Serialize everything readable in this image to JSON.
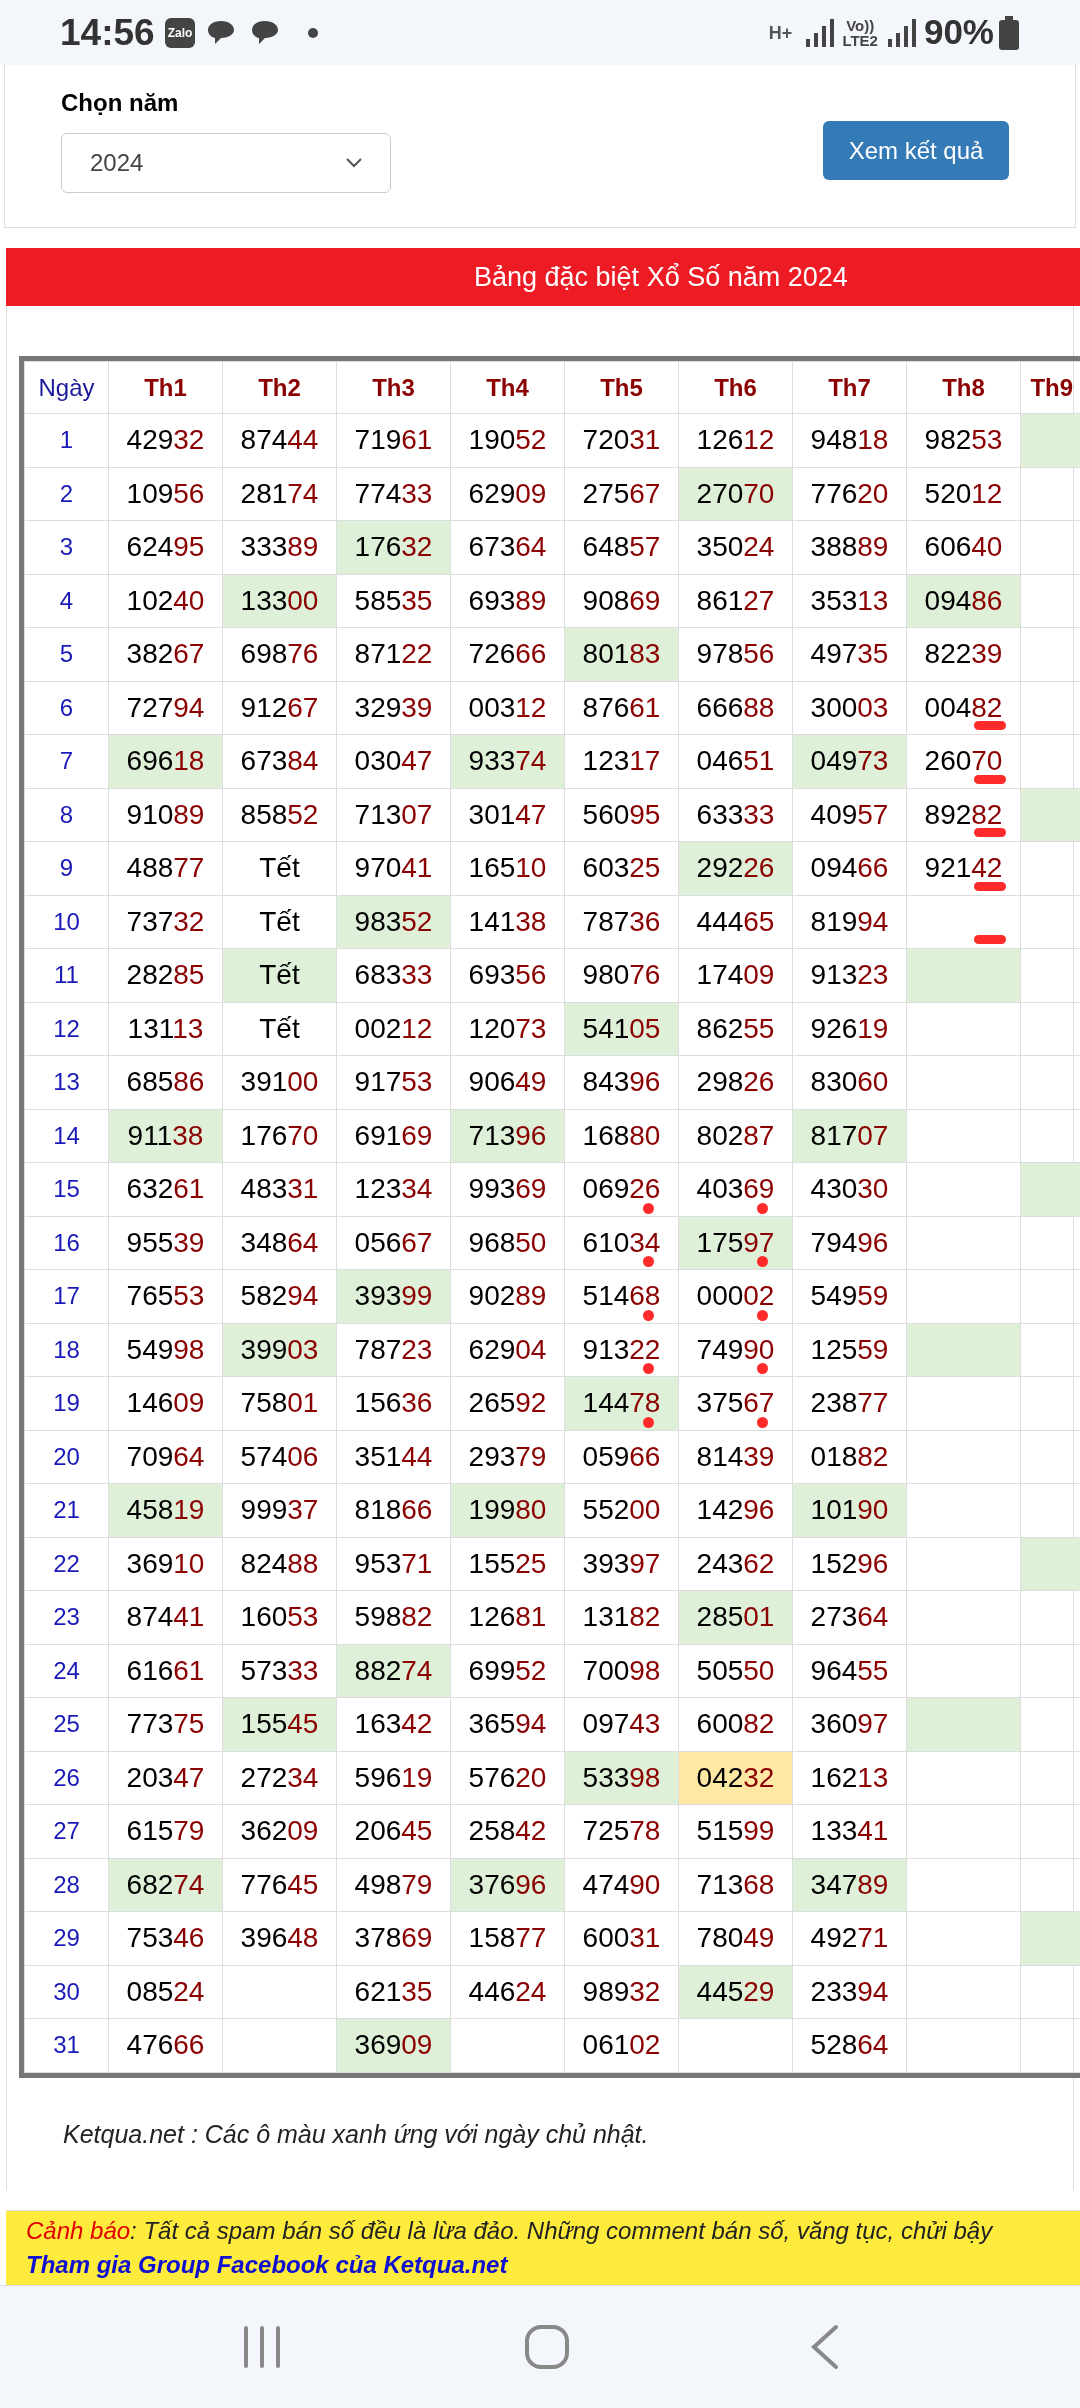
{
  "status_bar": {
    "time": "14:56",
    "app_badge": "Zalo",
    "network": "H+",
    "volte": "Vo))",
    "lte": "LTE2",
    "battery": "90%"
  },
  "year_form": {
    "label": "Chọn năm",
    "select_value": "2024",
    "button": "Xem kết quả"
  },
  "banner": {
    "title": "Bảng đặc biệt Xổ Số năm 2024"
  },
  "table": {
    "columns": [
      "Ngày",
      "Th1",
      "Th2",
      "Th3",
      "Th4",
      "Th5",
      "Th6",
      "Th7",
      "Th8",
      "Th9"
    ],
    "rows": [
      {
        "cells": [
          {
            "kind": "day",
            "value": "1"
          },
          {
            "kind": "number",
            "head": "429",
            "tail": "32"
          },
          {
            "kind": "number",
            "head": "874",
            "tail": "44"
          },
          {
            "kind": "number",
            "head": "719",
            "tail": "61"
          },
          {
            "kind": "number",
            "head": "190",
            "tail": "52"
          },
          {
            "kind": "number",
            "head": "720",
            "tail": "31"
          },
          {
            "kind": "number",
            "head": "126",
            "tail": "12"
          },
          {
            "kind": "number",
            "head": "948",
            "tail": "18"
          },
          {
            "kind": "number",
            "head": "982",
            "tail": "53"
          },
          {
            "kind": "blank",
            "sunday": true
          }
        ]
      },
      {
        "cells": [
          {
            "kind": "day",
            "value": "2"
          },
          {
            "kind": "number",
            "head": "109",
            "tail": "56"
          },
          {
            "kind": "number",
            "head": "281",
            "tail": "74"
          },
          {
            "kind": "number",
            "head": "774",
            "tail": "33"
          },
          {
            "kind": "number",
            "head": "629",
            "tail": "09"
          },
          {
            "kind": "number",
            "head": "275",
            "tail": "67"
          },
          {
            "kind": "number",
            "head": "270",
            "tail": "70",
            "sunday": true
          },
          {
            "kind": "number",
            "head": "776",
            "tail": "20"
          },
          {
            "kind": "number",
            "head": "520",
            "tail": "12"
          },
          {
            "kind": "blank"
          }
        ]
      },
      {
        "cells": [
          {
            "kind": "day",
            "value": "3"
          },
          {
            "kind": "number",
            "head": "624",
            "tail": "95"
          },
          {
            "kind": "number",
            "head": "333",
            "tail": "89"
          },
          {
            "kind": "number",
            "head": "176",
            "tail": "32",
            "sunday": true
          },
          {
            "kind": "number",
            "head": "673",
            "tail": "64"
          },
          {
            "kind": "number",
            "head": "648",
            "tail": "57"
          },
          {
            "kind": "number",
            "head": "350",
            "tail": "24"
          },
          {
            "kind": "number",
            "head": "388",
            "tail": "89"
          },
          {
            "kind": "number",
            "head": "606",
            "tail": "40"
          },
          {
            "kind": "blank"
          }
        ]
      },
      {
        "cells": [
          {
            "kind": "day",
            "value": "4"
          },
          {
            "kind": "number",
            "head": "102",
            "tail": "40"
          },
          {
            "kind": "number",
            "head": "133",
            "tail": "00",
            "sunday": true
          },
          {
            "kind": "number",
            "head": "585",
            "tail": "35"
          },
          {
            "kind": "number",
            "head": "693",
            "tail": "89"
          },
          {
            "kind": "number",
            "head": "908",
            "tail": "69"
          },
          {
            "kind": "number",
            "head": "861",
            "tail": "27"
          },
          {
            "kind": "number",
            "head": "353",
            "tail": "13"
          },
          {
            "kind": "number",
            "head": "094",
            "tail": "86",
            "sunday": true
          },
          {
            "kind": "blank"
          }
        ]
      },
      {
        "cells": [
          {
            "kind": "day",
            "value": "5"
          },
          {
            "kind": "number",
            "head": "382",
            "tail": "67"
          },
          {
            "kind": "number",
            "head": "698",
            "tail": "76"
          },
          {
            "kind": "number",
            "head": "871",
            "tail": "22"
          },
          {
            "kind": "number",
            "head": "726",
            "tail": "66"
          },
          {
            "kind": "number",
            "head": "801",
            "tail": "83",
            "sunday": true
          },
          {
            "kind": "number",
            "head": "978",
            "tail": "56"
          },
          {
            "kind": "number",
            "head": "497",
            "tail": "35"
          },
          {
            "kind": "number",
            "head": "822",
            "tail": "39"
          },
          {
            "kind": "blank"
          }
        ]
      },
      {
        "cells": [
          {
            "kind": "day",
            "value": "6"
          },
          {
            "kind": "number",
            "head": "727",
            "tail": "94"
          },
          {
            "kind": "number",
            "head": "912",
            "tail": "67"
          },
          {
            "kind": "number",
            "head": "329",
            "tail": "39"
          },
          {
            "kind": "number",
            "head": "003",
            "tail": "12"
          },
          {
            "kind": "number",
            "head": "876",
            "tail": "61"
          },
          {
            "kind": "number",
            "head": "666",
            "tail": "88"
          },
          {
            "kind": "number",
            "head": "300",
            "tail": "03"
          },
          {
            "kind": "number",
            "head": "004",
            "tail": "82",
            "pen_dash": true
          },
          {
            "kind": "blank"
          }
        ]
      },
      {
        "cells": [
          {
            "kind": "day",
            "value": "7"
          },
          {
            "kind": "number",
            "head": "696",
            "tail": "18",
            "sunday": true
          },
          {
            "kind": "number",
            "head": "673",
            "tail": "84"
          },
          {
            "kind": "number",
            "head": "030",
            "tail": "47"
          },
          {
            "kind": "number",
            "head": "933",
            "tail": "74",
            "sunday": true
          },
          {
            "kind": "number",
            "head": "123",
            "tail": "17"
          },
          {
            "kind": "number",
            "head": "046",
            "tail": "51"
          },
          {
            "kind": "number",
            "head": "049",
            "tail": "73",
            "sunday": true
          },
          {
            "kind": "number",
            "head": "260",
            "tail": "70",
            "pen_dash": true
          },
          {
            "kind": "blank"
          }
        ]
      },
      {
        "cells": [
          {
            "kind": "day",
            "value": "8"
          },
          {
            "kind": "number",
            "head": "910",
            "tail": "89"
          },
          {
            "kind": "number",
            "head": "858",
            "tail": "52"
          },
          {
            "kind": "number",
            "head": "713",
            "tail": "07"
          },
          {
            "kind": "number",
            "head": "301",
            "tail": "47"
          },
          {
            "kind": "number",
            "head": "560",
            "tail": "95"
          },
          {
            "kind": "number",
            "head": "633",
            "tail": "33"
          },
          {
            "kind": "number",
            "head": "409",
            "tail": "57"
          },
          {
            "kind": "number",
            "head": "892",
            "tail": "82",
            "pen_dash": true
          },
          {
            "kind": "blank",
            "sunday": true
          }
        ]
      },
      {
        "cells": [
          {
            "kind": "day",
            "value": "9"
          },
          {
            "kind": "number",
            "head": "488",
            "tail": "77"
          },
          {
            "kind": "text",
            "value": "Tết"
          },
          {
            "kind": "number",
            "head": "970",
            "tail": "41"
          },
          {
            "kind": "number",
            "head": "165",
            "tail": "10"
          },
          {
            "kind": "number",
            "head": "603",
            "tail": "25"
          },
          {
            "kind": "number",
            "head": "292",
            "tail": "26",
            "sunday": true
          },
          {
            "kind": "number",
            "head": "094",
            "tail": "66"
          },
          {
            "kind": "number",
            "head": "921",
            "tail": "42",
            "pen_dash": true
          },
          {
            "kind": "blank"
          }
        ]
      },
      {
        "cells": [
          {
            "kind": "day",
            "value": "10"
          },
          {
            "kind": "number",
            "head": "737",
            "tail": "32"
          },
          {
            "kind": "text",
            "value": "Tết"
          },
          {
            "kind": "number",
            "head": "983",
            "tail": "52",
            "sunday": true
          },
          {
            "kind": "number",
            "head": "141",
            "tail": "38"
          },
          {
            "kind": "number",
            "head": "787",
            "tail": "36"
          },
          {
            "kind": "number",
            "head": "444",
            "tail": "65"
          },
          {
            "kind": "number",
            "head": "819",
            "tail": "94"
          },
          {
            "kind": "blank",
            "pen_dash": true
          },
          {
            "kind": "blank"
          }
        ]
      },
      {
        "cells": [
          {
            "kind": "day",
            "value": "11"
          },
          {
            "kind": "number",
            "head": "282",
            "tail": "85"
          },
          {
            "kind": "text",
            "value": "Tết",
            "sunday": true
          },
          {
            "kind": "number",
            "head": "683",
            "tail": "33"
          },
          {
            "kind": "number",
            "head": "693",
            "tail": "56"
          },
          {
            "kind": "number",
            "head": "980",
            "tail": "76"
          },
          {
            "kind": "number",
            "head": "174",
            "tail": "09"
          },
          {
            "kind": "number",
            "head": "913",
            "tail": "23"
          },
          {
            "kind": "blank",
            "sunday": true
          },
          {
            "kind": "blank"
          }
        ]
      },
      {
        "cells": [
          {
            "kind": "day",
            "value": "12"
          },
          {
            "kind": "number",
            "head": "131",
            "tail": "13"
          },
          {
            "kind": "text",
            "value": "Tết"
          },
          {
            "kind": "number",
            "head": "002",
            "tail": "12"
          },
          {
            "kind": "number",
            "head": "120",
            "tail": "73"
          },
          {
            "kind": "number",
            "head": "541",
            "tail": "05",
            "sunday": true
          },
          {
            "kind": "number",
            "head": "862",
            "tail": "55"
          },
          {
            "kind": "number",
            "head": "926",
            "tail": "19"
          },
          {
            "kind": "blank"
          },
          {
            "kind": "blank"
          }
        ]
      },
      {
        "cells": [
          {
            "kind": "day",
            "value": "13"
          },
          {
            "kind": "number",
            "head": "685",
            "tail": "86"
          },
          {
            "kind": "number",
            "head": "391",
            "tail": "00"
          },
          {
            "kind": "number",
            "head": "917",
            "tail": "53"
          },
          {
            "kind": "number",
            "head": "906",
            "tail": "49"
          },
          {
            "kind": "number",
            "head": "843",
            "tail": "96"
          },
          {
            "kind": "number",
            "head": "298",
            "tail": "26"
          },
          {
            "kind": "number",
            "head": "830",
            "tail": "60"
          },
          {
            "kind": "blank"
          },
          {
            "kind": "blank"
          }
        ]
      },
      {
        "cells": [
          {
            "kind": "day",
            "value": "14"
          },
          {
            "kind": "number",
            "head": "911",
            "tail": "38",
            "sunday": true
          },
          {
            "kind": "number",
            "head": "176",
            "tail": "70"
          },
          {
            "kind": "number",
            "head": "691",
            "tail": "69"
          },
          {
            "kind": "number",
            "head": "713",
            "tail": "96",
            "sunday": true
          },
          {
            "kind": "number",
            "head": "168",
            "tail": "80"
          },
          {
            "kind": "number",
            "head": "802",
            "tail": "87"
          },
          {
            "kind": "number",
            "head": "817",
            "tail": "07",
            "sunday": true
          },
          {
            "kind": "blank"
          },
          {
            "kind": "blank"
          }
        ]
      },
      {
        "cells": [
          {
            "kind": "day",
            "value": "15"
          },
          {
            "kind": "number",
            "head": "632",
            "tail": "61"
          },
          {
            "kind": "number",
            "head": "483",
            "tail": "31"
          },
          {
            "kind": "number",
            "head": "123",
            "tail": "34"
          },
          {
            "kind": "number",
            "head": "993",
            "tail": "69"
          },
          {
            "kind": "number",
            "head": "069",
            "tail": "26",
            "pen_dot": true
          },
          {
            "kind": "number",
            "head": "403",
            "tail": "69",
            "pen_dot": true
          },
          {
            "kind": "number",
            "head": "430",
            "tail": "30"
          },
          {
            "kind": "blank"
          },
          {
            "kind": "blank",
            "sunday": true
          }
        ]
      },
      {
        "cells": [
          {
            "kind": "day",
            "value": "16"
          },
          {
            "kind": "number",
            "head": "955",
            "tail": "39"
          },
          {
            "kind": "number",
            "head": "348",
            "tail": "64"
          },
          {
            "kind": "number",
            "head": "056",
            "tail": "67"
          },
          {
            "kind": "number",
            "head": "968",
            "tail": "50"
          },
          {
            "kind": "number",
            "head": "610",
            "tail": "34",
            "pen_dot": true
          },
          {
            "kind": "number",
            "head": "175",
            "tail": "97",
            "sunday": true,
            "pen_dot": true
          },
          {
            "kind": "number",
            "head": "794",
            "tail": "96"
          },
          {
            "kind": "blank"
          },
          {
            "kind": "blank"
          }
        ]
      },
      {
        "cells": [
          {
            "kind": "day",
            "value": "17"
          },
          {
            "kind": "number",
            "head": "765",
            "tail": "53"
          },
          {
            "kind": "number",
            "head": "582",
            "tail": "94"
          },
          {
            "kind": "number",
            "head": "393",
            "tail": "99",
            "sunday": true
          },
          {
            "kind": "number",
            "head": "902",
            "tail": "89"
          },
          {
            "kind": "number",
            "head": "514",
            "tail": "68",
            "pen_dot": true
          },
          {
            "kind": "number",
            "head": "000",
            "tail": "02",
            "pen_dot": true
          },
          {
            "kind": "number",
            "head": "549",
            "tail": "59"
          },
          {
            "kind": "blank"
          },
          {
            "kind": "blank"
          }
        ]
      },
      {
        "cells": [
          {
            "kind": "day",
            "value": "18"
          },
          {
            "kind": "number",
            "head": "549",
            "tail": "98"
          },
          {
            "kind": "number",
            "head": "399",
            "tail": "03",
            "sunday": true
          },
          {
            "kind": "number",
            "head": "787",
            "tail": "23"
          },
          {
            "kind": "number",
            "head": "629",
            "tail": "04"
          },
          {
            "kind": "number",
            "head": "913",
            "tail": "22",
            "pen_dot": true
          },
          {
            "kind": "number",
            "head": "749",
            "tail": "90",
            "pen_dot": true
          },
          {
            "kind": "number",
            "head": "125",
            "tail": "59"
          },
          {
            "kind": "blank",
            "sunday": true
          },
          {
            "kind": "blank"
          }
        ]
      },
      {
        "cells": [
          {
            "kind": "day",
            "value": "19"
          },
          {
            "kind": "number",
            "head": "146",
            "tail": "09"
          },
          {
            "kind": "number",
            "head": "758",
            "tail": "01"
          },
          {
            "kind": "number",
            "head": "156",
            "tail": "36"
          },
          {
            "kind": "number",
            "head": "265",
            "tail": "92"
          },
          {
            "kind": "number",
            "head": "144",
            "tail": "78",
            "sunday": true,
            "pen_dot": true
          },
          {
            "kind": "number",
            "head": "375",
            "tail": "67",
            "pen_dot": true
          },
          {
            "kind": "number",
            "head": "238",
            "tail": "77"
          },
          {
            "kind": "blank"
          },
          {
            "kind": "blank"
          }
        ]
      },
      {
        "cells": [
          {
            "kind": "day",
            "value": "20"
          },
          {
            "kind": "number",
            "head": "709",
            "tail": "64"
          },
          {
            "kind": "number",
            "head": "574",
            "tail": "06"
          },
          {
            "kind": "number",
            "head": "351",
            "tail": "44"
          },
          {
            "kind": "number",
            "head": "293",
            "tail": "79"
          },
          {
            "kind": "number",
            "head": "059",
            "tail": "66"
          },
          {
            "kind": "number",
            "head": "814",
            "tail": "39"
          },
          {
            "kind": "number",
            "head": "018",
            "tail": "82"
          },
          {
            "kind": "blank"
          },
          {
            "kind": "blank"
          }
        ]
      },
      {
        "cells": [
          {
            "kind": "day",
            "value": "21"
          },
          {
            "kind": "number",
            "head": "458",
            "tail": "19",
            "sunday": true
          },
          {
            "kind": "number",
            "head": "999",
            "tail": "37"
          },
          {
            "kind": "number",
            "head": "818",
            "tail": "66"
          },
          {
            "kind": "number",
            "head": "199",
            "tail": "80",
            "sunday": true
          },
          {
            "kind": "number",
            "head": "552",
            "tail": "00"
          },
          {
            "kind": "number",
            "head": "142",
            "tail": "96"
          },
          {
            "kind": "number",
            "head": "101",
            "tail": "90",
            "sunday": true
          },
          {
            "kind": "blank"
          },
          {
            "kind": "blank"
          }
        ]
      },
      {
        "cells": [
          {
            "kind": "day",
            "value": "22"
          },
          {
            "kind": "number",
            "head": "369",
            "tail": "10"
          },
          {
            "kind": "number",
            "head": "824",
            "tail": "88"
          },
          {
            "kind": "number",
            "head": "953",
            "tail": "71"
          },
          {
            "kind": "number",
            "head": "155",
            "tail": "25"
          },
          {
            "kind": "number",
            "head": "393",
            "tail": "97"
          },
          {
            "kind": "number",
            "head": "243",
            "tail": "62"
          },
          {
            "kind": "number",
            "head": "152",
            "tail": "96"
          },
          {
            "kind": "blank"
          },
          {
            "kind": "blank",
            "sunday": true
          }
        ]
      },
      {
        "cells": [
          {
            "kind": "day",
            "value": "23"
          },
          {
            "kind": "number",
            "head": "874",
            "tail": "41"
          },
          {
            "kind": "number",
            "head": "160",
            "tail": "53"
          },
          {
            "kind": "number",
            "head": "598",
            "tail": "82"
          },
          {
            "kind": "number",
            "head": "126",
            "tail": "81"
          },
          {
            "kind": "number",
            "head": "131",
            "tail": "82"
          },
          {
            "kind": "number",
            "head": "285",
            "tail": "01",
            "sunday": true
          },
          {
            "kind": "number",
            "head": "273",
            "tail": "64"
          },
          {
            "kind": "blank"
          },
          {
            "kind": "blank"
          }
        ]
      },
      {
        "cells": [
          {
            "kind": "day",
            "value": "24"
          },
          {
            "kind": "number",
            "head": "616",
            "tail": "61"
          },
          {
            "kind": "number",
            "head": "573",
            "tail": "33"
          },
          {
            "kind": "number",
            "head": "882",
            "tail": "74",
            "sunday": true
          },
          {
            "kind": "number",
            "head": "699",
            "tail": "52"
          },
          {
            "kind": "number",
            "head": "700",
            "tail": "98"
          },
          {
            "kind": "number",
            "head": "505",
            "tail": "50"
          },
          {
            "kind": "number",
            "head": "964",
            "tail": "55"
          },
          {
            "kind": "blank"
          },
          {
            "kind": "blank"
          }
        ]
      },
      {
        "cells": [
          {
            "kind": "day",
            "value": "25"
          },
          {
            "kind": "number",
            "head": "773",
            "tail": "75"
          },
          {
            "kind": "number",
            "head": "155",
            "tail": "45",
            "sunday": true
          },
          {
            "kind": "number",
            "head": "163",
            "tail": "42"
          },
          {
            "kind": "number",
            "head": "365",
            "tail": "94"
          },
          {
            "kind": "number",
            "head": "097",
            "tail": "43"
          },
          {
            "kind": "number",
            "head": "600",
            "tail": "82"
          },
          {
            "kind": "number",
            "head": "360",
            "tail": "97"
          },
          {
            "kind": "blank",
            "sunday": true
          },
          {
            "kind": "blank"
          }
        ]
      },
      {
        "cells": [
          {
            "kind": "day",
            "value": "26"
          },
          {
            "kind": "number",
            "head": "203",
            "tail": "47"
          },
          {
            "kind": "number",
            "head": "272",
            "tail": "34"
          },
          {
            "kind": "number",
            "head": "596",
            "tail": "19"
          },
          {
            "kind": "number",
            "head": "576",
            "tail": "20"
          },
          {
            "kind": "number",
            "head": "533",
            "tail": "98",
            "sunday": true
          },
          {
            "kind": "number",
            "head": "042",
            "tail": "32",
            "today": true
          },
          {
            "kind": "number",
            "head": "162",
            "tail": "13"
          },
          {
            "kind": "blank"
          },
          {
            "kind": "blank"
          }
        ]
      },
      {
        "cells": [
          {
            "kind": "day",
            "value": "27"
          },
          {
            "kind": "number",
            "head": "615",
            "tail": "79"
          },
          {
            "kind": "number",
            "head": "362",
            "tail": "09"
          },
          {
            "kind": "number",
            "head": "206",
            "tail": "45"
          },
          {
            "kind": "number",
            "head": "258",
            "tail": "42"
          },
          {
            "kind": "number",
            "head": "725",
            "tail": "78"
          },
          {
            "kind": "number",
            "head": "515",
            "tail": "99"
          },
          {
            "kind": "number",
            "head": "133",
            "tail": "41"
          },
          {
            "kind": "blank"
          },
          {
            "kind": "blank"
          }
        ]
      },
      {
        "cells": [
          {
            "kind": "day",
            "value": "28"
          },
          {
            "kind": "number",
            "head": "682",
            "tail": "74",
            "sunday": true
          },
          {
            "kind": "number",
            "head": "776",
            "tail": "45"
          },
          {
            "kind": "number",
            "head": "498",
            "tail": "79"
          },
          {
            "kind": "number",
            "head": "376",
            "tail": "96",
            "sunday": true
          },
          {
            "kind": "number",
            "head": "474",
            "tail": "90"
          },
          {
            "kind": "number",
            "head": "713",
            "tail": "68"
          },
          {
            "kind": "number",
            "head": "347",
            "tail": "89",
            "sunday": true
          },
          {
            "kind": "blank"
          },
          {
            "kind": "blank"
          }
        ]
      },
      {
        "cells": [
          {
            "kind": "day",
            "value": "29"
          },
          {
            "kind": "number",
            "head": "753",
            "tail": "46"
          },
          {
            "kind": "number",
            "head": "396",
            "tail": "48"
          },
          {
            "kind": "number",
            "head": "378",
            "tail": "69"
          },
          {
            "kind": "number",
            "head": "158",
            "tail": "77"
          },
          {
            "kind": "number",
            "head": "600",
            "tail": "31"
          },
          {
            "kind": "number",
            "head": "780",
            "tail": "49"
          },
          {
            "kind": "number",
            "head": "492",
            "tail": "71"
          },
          {
            "kind": "blank"
          },
          {
            "kind": "blank",
            "sunday": true
          }
        ]
      },
      {
        "cells": [
          {
            "kind": "day",
            "value": "30"
          },
          {
            "kind": "number",
            "head": "085",
            "tail": "24"
          },
          {
            "kind": "blank"
          },
          {
            "kind": "number",
            "head": "621",
            "tail": "35"
          },
          {
            "kind": "number",
            "head": "446",
            "tail": "24"
          },
          {
            "kind": "number",
            "head": "989",
            "tail": "32"
          },
          {
            "kind": "number",
            "head": "445",
            "tail": "29",
            "sunday": true
          },
          {
            "kind": "number",
            "head": "233",
            "tail": "94"
          },
          {
            "kind": "blank"
          },
          {
            "kind": "blank"
          }
        ]
      },
      {
        "cells": [
          {
            "kind": "day",
            "value": "31"
          },
          {
            "kind": "number",
            "head": "476",
            "tail": "66"
          },
          {
            "kind": "blank"
          },
          {
            "kind": "number",
            "head": "369",
            "tail": "09",
            "sunday": true
          },
          {
            "kind": "blank"
          },
          {
            "kind": "number",
            "head": "061",
            "tail": "02"
          },
          {
            "kind": "blank"
          },
          {
            "kind": "number",
            "head": "528",
            "tail": "64"
          },
          {
            "kind": "blank"
          },
          {
            "kind": "blank"
          }
        ]
      }
    ]
  },
  "note": "Ketqua.net : Các ô màu xanh ứng với ngày chủ nhật.",
  "warning": {
    "label": "Cảnh báo",
    "text": ": Tất cả spam bán số đều là lừa đảo. Những comment bán số, văng tục, chửi bậy",
    "link": "Tham gia Group Facebook của Ketqua.net"
  }
}
